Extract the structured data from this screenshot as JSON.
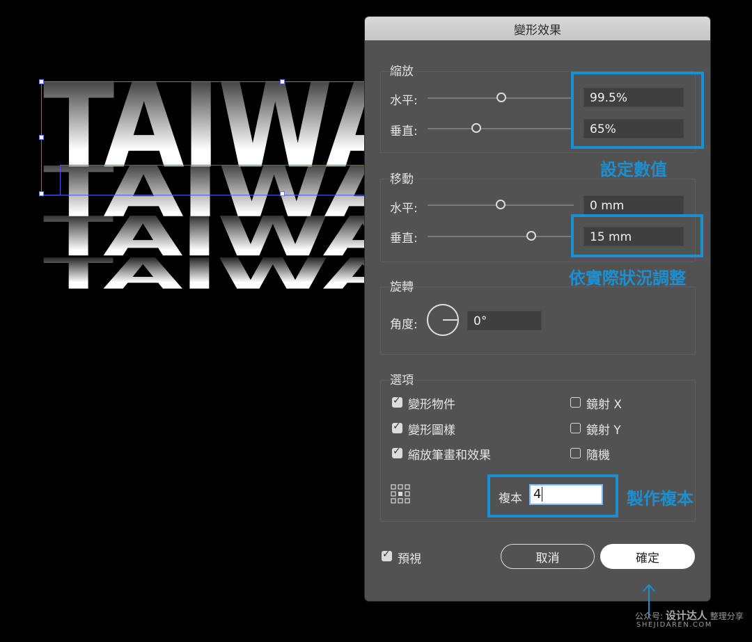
{
  "canvas": {
    "artwork_text": "TAIWAN"
  },
  "dialog": {
    "title": "變形效果",
    "scale": {
      "section": "縮放",
      "horizontal_label": "水平:",
      "horizontal_value": "99.5%",
      "vertical_label": "垂直:",
      "vertical_value": "65%"
    },
    "move": {
      "section": "移動",
      "horizontal_label": "水平:",
      "horizontal_value": "0 mm",
      "vertical_label": "垂直:",
      "vertical_value": "15 mm"
    },
    "rotate": {
      "section": "旋轉",
      "angle_label": "角度:",
      "angle_value": "0°"
    },
    "options": {
      "section": "選項",
      "transform_objects": "變形物件",
      "transform_patterns": "變形圖樣",
      "scale_strokes": "縮放筆畫和效果",
      "reflect_x": "鏡射 X",
      "reflect_y": "鏡射 Y",
      "random": "隨機",
      "copies_label": "複本",
      "copies_value": "4"
    },
    "preview_label": "預視",
    "cancel_label": "取消",
    "ok_label": "確定"
  },
  "annotations": {
    "set_values": "設定數值",
    "adjust": "依實際狀況調整",
    "make_copies": "製作複本"
  },
  "watermark": {
    "line1_prefix": "公众号:",
    "line1_brand": "设计达人",
    "line1_suffix": "整理分享",
    "line2": "SHEJIDAREN.COM"
  },
  "colors": {
    "annotation": "#1c8fd0",
    "selection": "#5a6cff"
  }
}
